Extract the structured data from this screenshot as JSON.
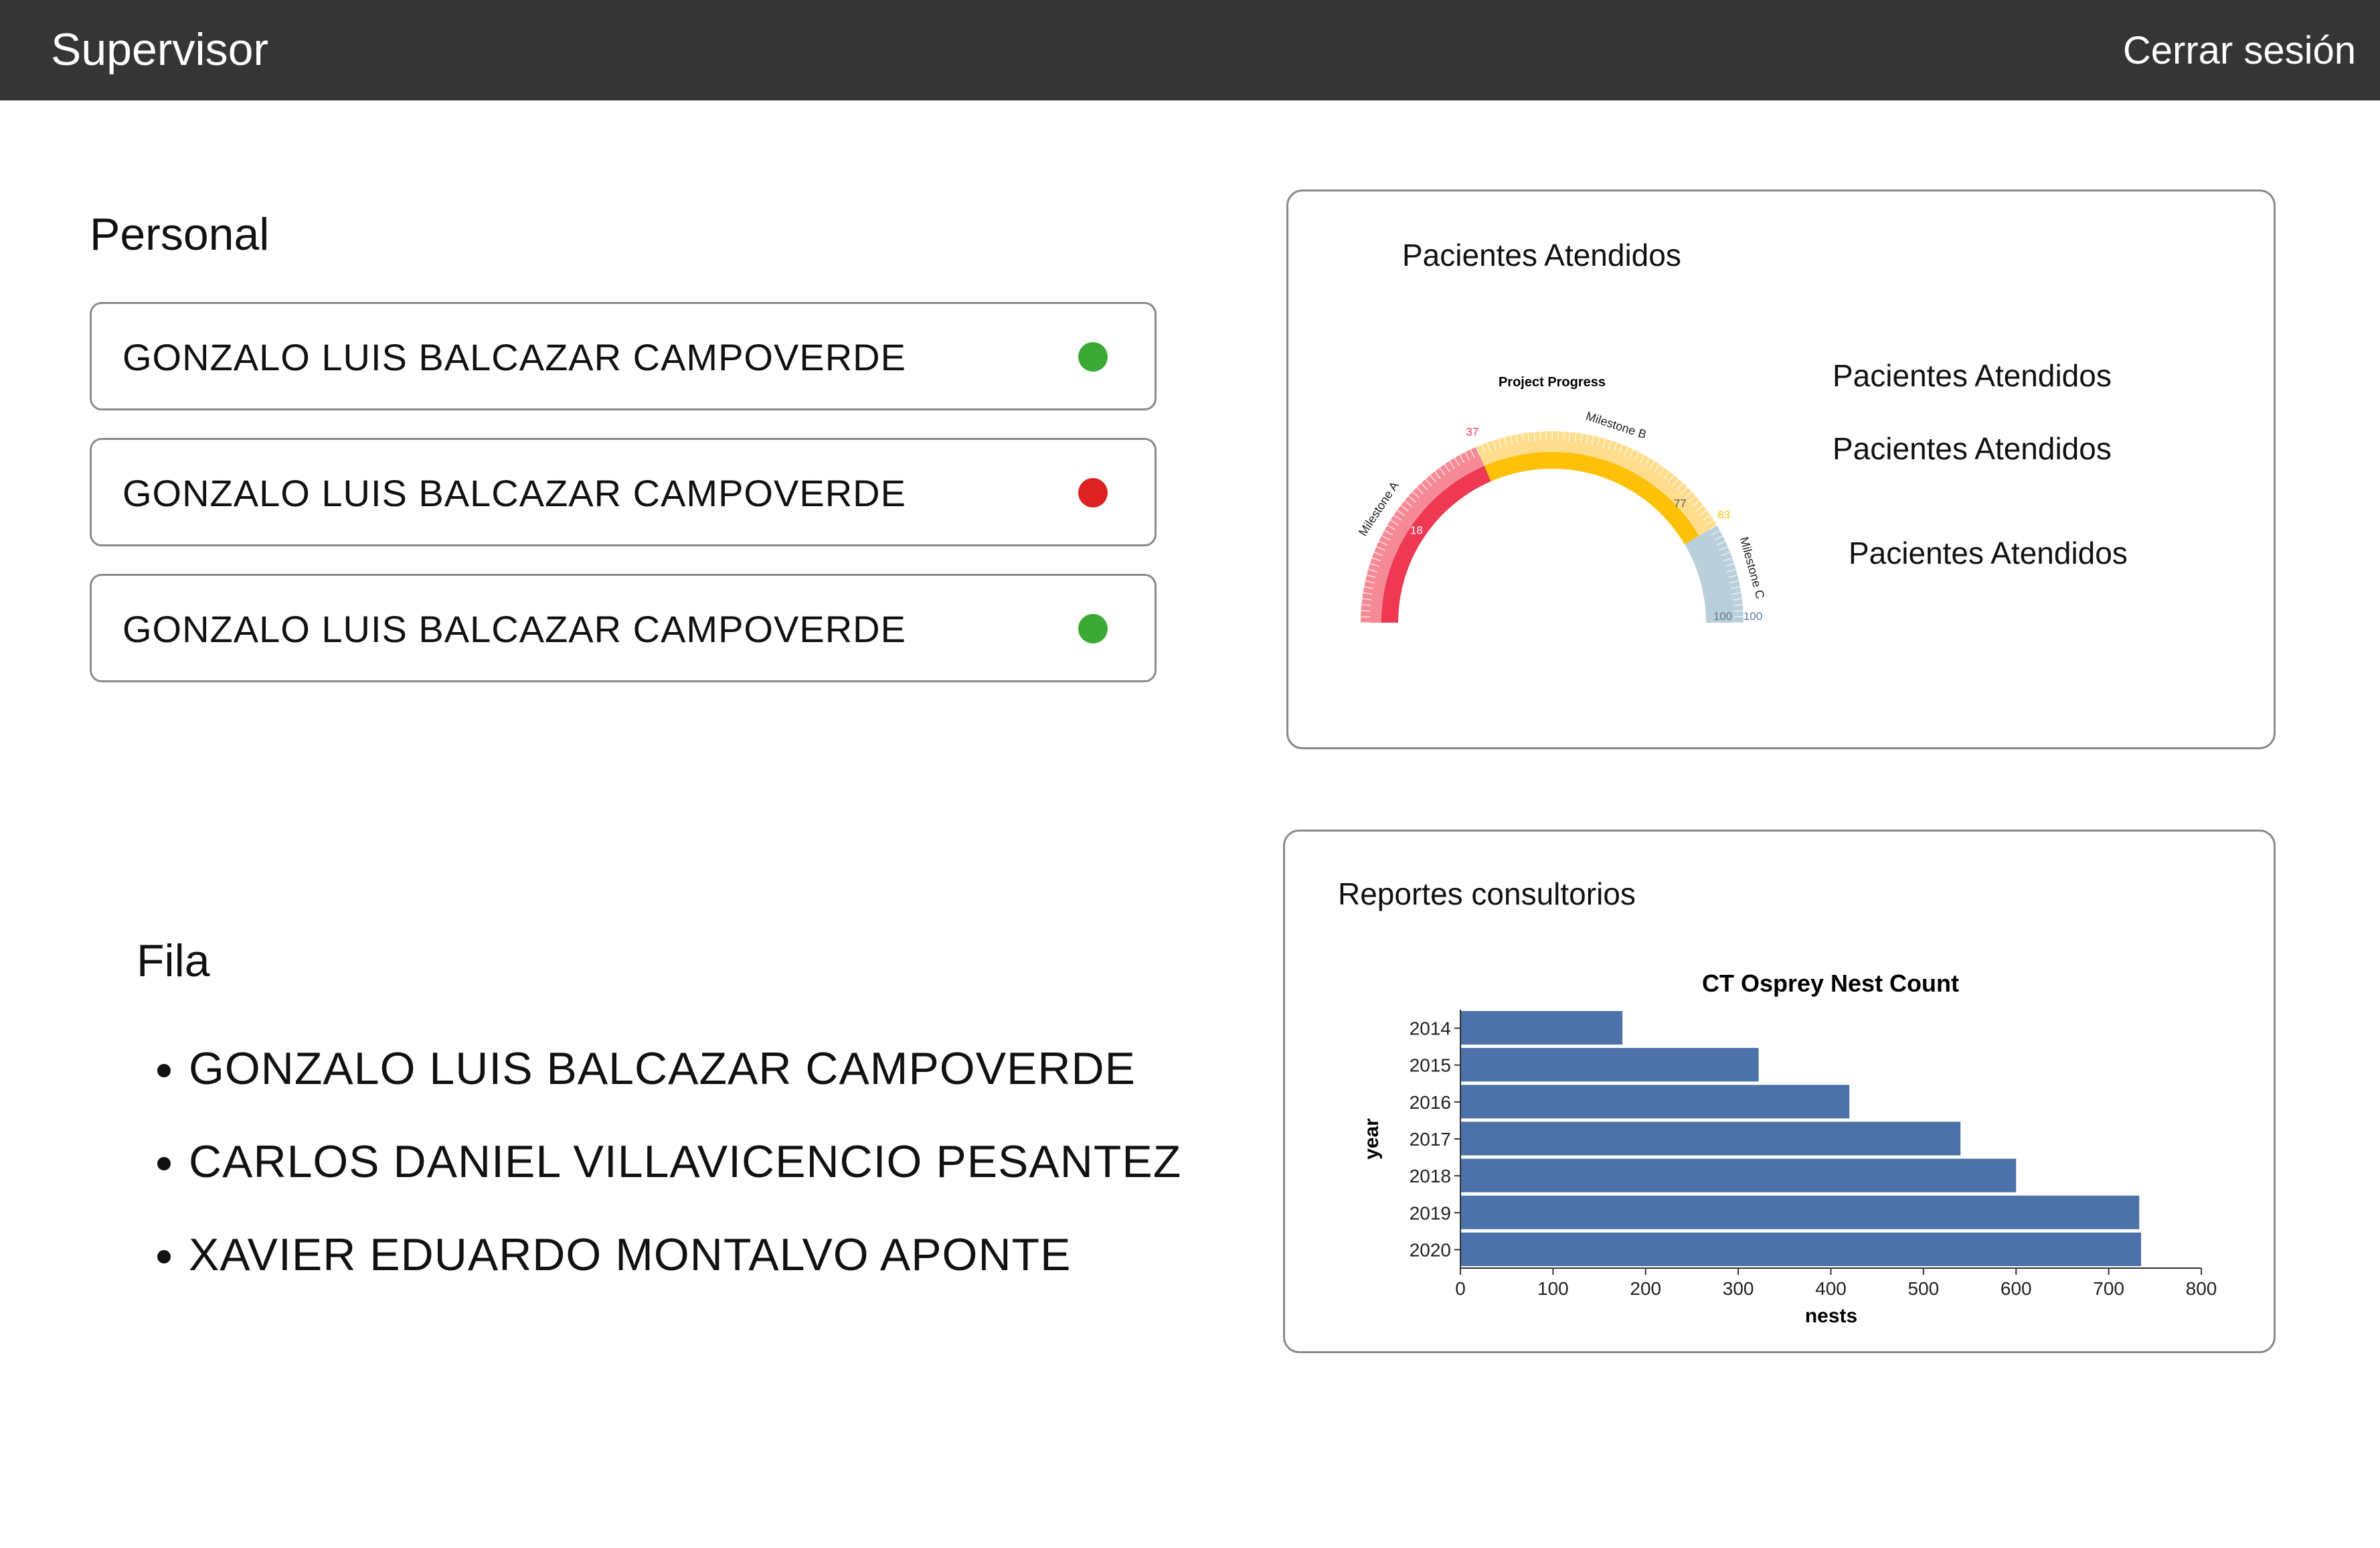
{
  "header": {
    "title": "Supervisor",
    "logout_label": "Cerrar sesión"
  },
  "staff": {
    "title": "Personal",
    "members": [
      {
        "name": "GONZALO LUIS BALCAZAR CAMPOVERDE",
        "status_color": "#3aaa35"
      },
      {
        "name": "GONZALO LUIS BALCAZAR CAMPOVERDE",
        "status_color": "#dd2222"
      },
      {
        "name": "GONZALO LUIS BALCAZAR CAMPOVERDE",
        "status_color": "#3aaa35"
      }
    ]
  },
  "queue": {
    "title": "Fila",
    "items": [
      "GONZALO LUIS BALCAZAR CAMPOVERDE",
      "CARLOS DANIEL VILLAVICENCIO PESANTEZ",
      "XAVIER EDUARDO MONTALVO APONTE"
    ]
  },
  "patients_panel": {
    "title": "Pacientes Atendidos",
    "labels": [
      "Pacientes Atendidos",
      "Pacientes Atendidos",
      "Pacientes Atendidos"
    ]
  },
  "reports_panel": {
    "title": "Reportes consultorios"
  },
  "chart_data": [
    {
      "type": "gauge",
      "title": "Project Progress",
      "min": 0,
      "max": 100,
      "inner_value": 83,
      "segments": [
        {
          "name": "Milestone A",
          "from": 0,
          "to": 37,
          "color": "#ef3852",
          "light_color": "#f58a96"
        },
        {
          "name": "Milestone B",
          "from": 37,
          "to": 83,
          "color": "#ffc107",
          "light_color": "#ffdd8c"
        },
        {
          "name": "Milestone C",
          "from": 83,
          "to": 100,
          "color": "#8fb0c2",
          "light_color": "#b9cfdb"
        }
      ],
      "tick_labels": [
        "37",
        "77",
        "83",
        "100",
        "100",
        "18"
      ]
    },
    {
      "type": "bar",
      "orientation": "horizontal",
      "title": "CT Osprey Nest Count",
      "xlabel": "nests",
      "ylabel": "year",
      "categories": [
        "2014",
        "2015",
        "2016",
        "2017",
        "2018",
        "2019",
        "2020"
      ],
      "values": [
        175,
        322,
        420,
        540,
        600,
        733,
        735
      ],
      "xlim": [
        0,
        800
      ],
      "xticks": [
        "0",
        "100",
        "200",
        "300",
        "400",
        "500",
        "600",
        "700",
        "800"
      ],
      "bar_color": "#4c72a9",
      "grid": false
    }
  ]
}
